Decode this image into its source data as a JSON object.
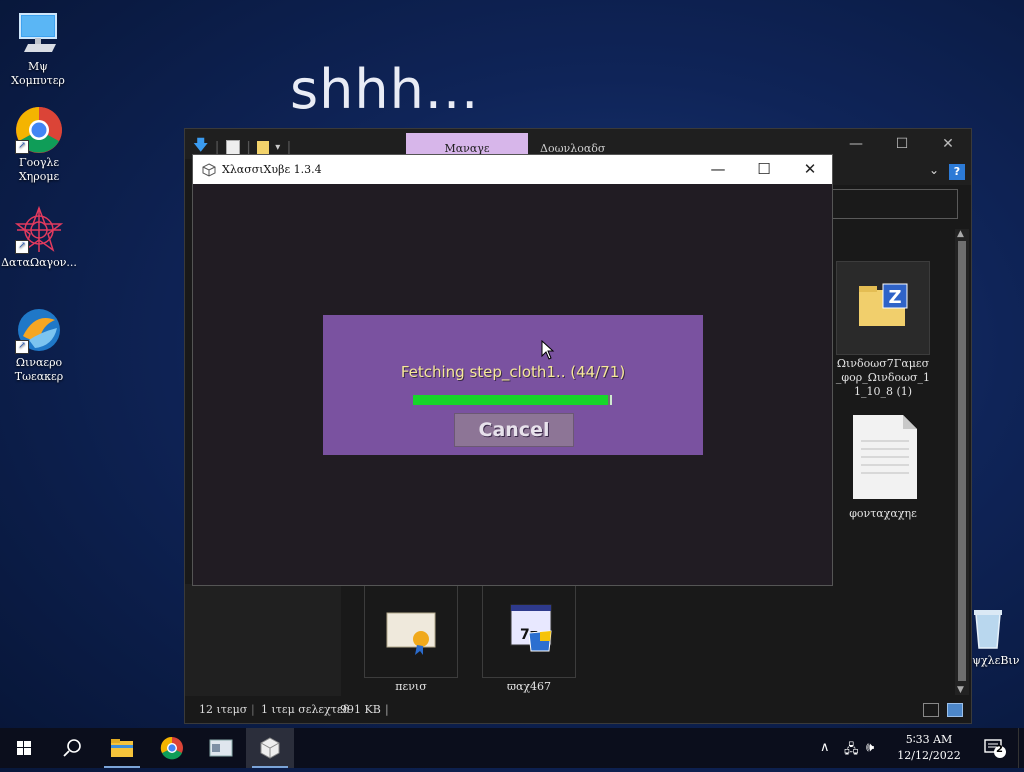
{
  "desktop": {
    "wallpaper_text": "shhh...",
    "icons": [
      {
        "label": "Μψ Χομπυτερ"
      },
      {
        "label": "Γοογλε Χηρομε"
      },
      {
        "label": "ΔαταΩαγον..."
      },
      {
        "label": "Ωιναερο Τωεακερ"
      },
      {
        "label": "ΡεχψχλεΒιν"
      }
    ]
  },
  "explorer": {
    "tabs": {
      "manage": "Μαναγε",
      "downloads": "Δοωνλοαδσ"
    },
    "files": [
      {
        "name": "Ωινδοωσ7Γαμεσ_φορ_Ωινδοωσ_11_10_8 (1)"
      },
      {
        "name": "φονταχαχηε"
      },
      {
        "name": "πενισ"
      },
      {
        "name": "ϖαχ467"
      }
    ],
    "status": {
      "items": "12 ιτεμσ",
      "selected": "1 ιτεμ σελεχτεδ",
      "size": "991 KB"
    }
  },
  "classicube": {
    "title": "ΧλασσιΧυβε 1.3.4",
    "fetch_text": "Fetching step_cloth1.. (44/71)",
    "progress": 0.98,
    "cancel_label": "Cancel"
  },
  "taskbar": {
    "time": "5∶33 AM",
    "date": "12/12/2022",
    "notifications": "2"
  },
  "colors": {
    "dialog_bg": "#7a52a0",
    "progress_fill": "#17d62a",
    "fetch_text": "#f6e899",
    "manage_tab": "#d7b6ea"
  }
}
